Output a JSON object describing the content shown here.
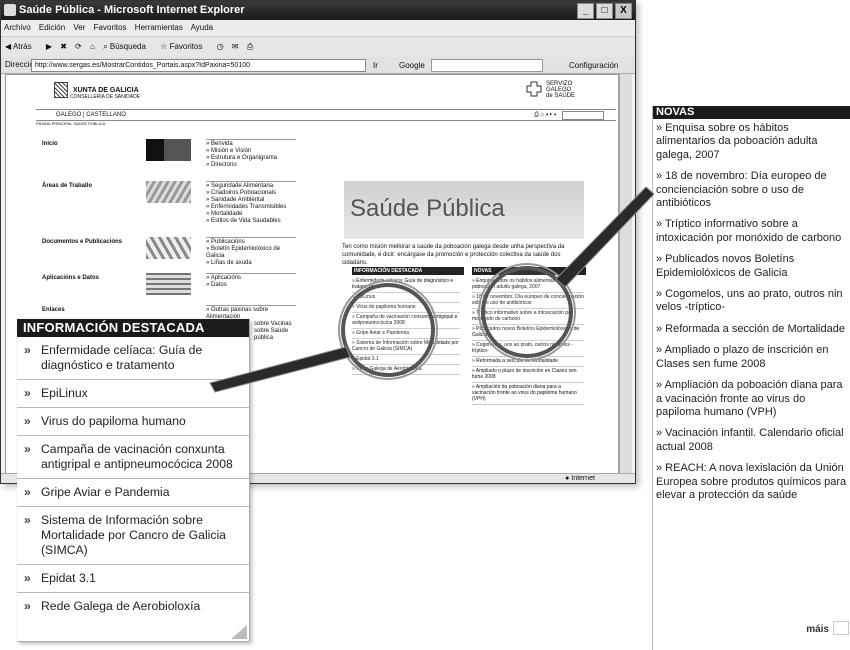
{
  "window": {
    "title": "Saúde Pública - Microsoft Internet Explorer",
    "controls": [
      "_",
      "□",
      "X"
    ]
  },
  "menubar": [
    "Archivo",
    "Edición",
    "Ver",
    "Favoritos",
    "Herramientas",
    "Ayuda"
  ],
  "toolbar": {
    "back": "Atrás",
    "search": "Búsqueda",
    "favorites": "Favoritos"
  },
  "addressbar": {
    "label": "Dirección",
    "url": "http://www.sergas.es/MostrarContidos_Portais.aspx?IdPaxina=50100",
    "go": "Ir",
    "search_label": "Google",
    "config": "Configuración"
  },
  "page": {
    "xunta_name": "XUNTA DE GALICIA",
    "xunta_sub": "CONSELLERÍA DE SANIDADE",
    "sergas": [
      "SERVIZO",
      "GALEGO",
      "de SAÚDE"
    ],
    "languages": [
      "GALEGO",
      "CASTELLANO"
    ],
    "crumb": "PÁXINA PRINCIPAL SAÚDE PÚBLICA",
    "sections": [
      {
        "title": "Inicio",
        "links": [
          "Benvida",
          "Misión e Visión",
          "Estrutura e Organigrama",
          "Directorio"
        ]
      },
      {
        "title": "Áreas de Traballo",
        "links": [
          "Seguridade Alimentaria",
          "Criadoiros Poboacionais",
          "Sanidade Ambiental",
          "Enfermidades Transmisibles",
          "Mortalidade",
          "Estilos de Vida Saudables"
        ]
      },
      {
        "title": "Documentos e Publicacións",
        "links": [
          "Publicacións",
          "Boletín Epidemiolóxico de Galicia",
          "Liñas de axuda"
        ]
      },
      {
        "title": "Aplicacións e Datos",
        "links": [
          "Aplicacións",
          "Datos"
        ]
      },
      {
        "title": "Enlaces",
        "links": [
          "Outras páxinas sobre Alimentación"
        ]
      }
    ],
    "hero_word": "Saúde Pública",
    "intro": "Ten como misión mellorar a saúde da poboación galega desde unha perspectiva da comunidade, é dicir: encárgase da promoción e protección colectiva da saúde dos cidadáns.",
    "mini_destacada_head": "INFORMACIÓN DESTACADA",
    "mini_novas_head": "NOVAS",
    "mini_destacada": [
      "Enfermidade celíaca: Guía de diagnóstico e tratamento",
      "EpiLinux",
      "Virus do papiloma humano",
      "Campaña de vacinación conxunta antigripal e antipneumocócica 2008",
      "Gripe Aviar e Pandemia",
      "Sistema de Información sobre Mortalidade por Cancro de Galicia (SIMCA)",
      "Epidat 3.1",
      "Rede Galega de Aerobioloxía"
    ],
    "mini_novas": [
      "Enquisa sobre os hábitos alimentarios da poboación adulta galega, 2007",
      "18 de novembro: Día europeo de concienciación sobre o uso de antibióticos",
      "Tríptico informativo sobre a intoxicación por monóxido de carbono",
      "Publicados novos Boletíns Epidemiolóxicos de Galicia",
      "Cogomelos, uns ao prato, outros nin velos -tríptico-",
      "Reformada a sección de Mortalidade",
      "Ampliado o plazo de inscrición en Clases sen fume 2008",
      "Ampliación da poboación diana para a vacinación fronte ao virus do papiloma humano (VPH)"
    ],
    "extra_links": [
      "sobre Vacinas",
      "sobre Saúde pública"
    ],
    "status": "Internet"
  },
  "destacada": {
    "title": "INFORMACIÓN DESTACADA",
    "items": [
      "Enfermidade celíaca: Guía de diagnóstico e tratamento",
      "EpiLinux",
      "Virus do papiloma humano",
      "Campaña de vacinación conxunta antigripal e antipneumocócica 2008",
      "Gripe Aviar e Pandemia",
      "Sistema de Información sobre Mortalidade por Cancro de Galicia (SIMCA)",
      "Epidat 3.1",
      "Rede Galega de Aerobioloxía"
    ]
  },
  "novas": {
    "title": "NOVAS",
    "items": [
      "» Enquisa sobre os hábitos alimentarios da poboación adulta galega, 2007",
      "» 18 de novembro: Día europeo de concienciación sobre o uso de antibióticos",
      "» Tríptico informativo sobre a intoxicación por monóxido de carbono",
      "» Publicados novos Boletíns Epidemiolóxicos de Galicia",
      "» Cogomelos, uns ao prato, outros nin velos -tríptico-",
      "» Reformada a sección de Mortalidade",
      "» Ampliado o plazo de inscrición en Clases sen fume 2008",
      "» Ampliación da poboación diana para a vacinación fronte ao virus do papiloma humano (VPH)",
      "» Vacinación infantil. Calendario oficial actual 2008",
      "» REACH: A nova lexislación da Unión Europea sobre produtos químicos para elevar a protección da saúde"
    ],
    "more": "máis"
  }
}
